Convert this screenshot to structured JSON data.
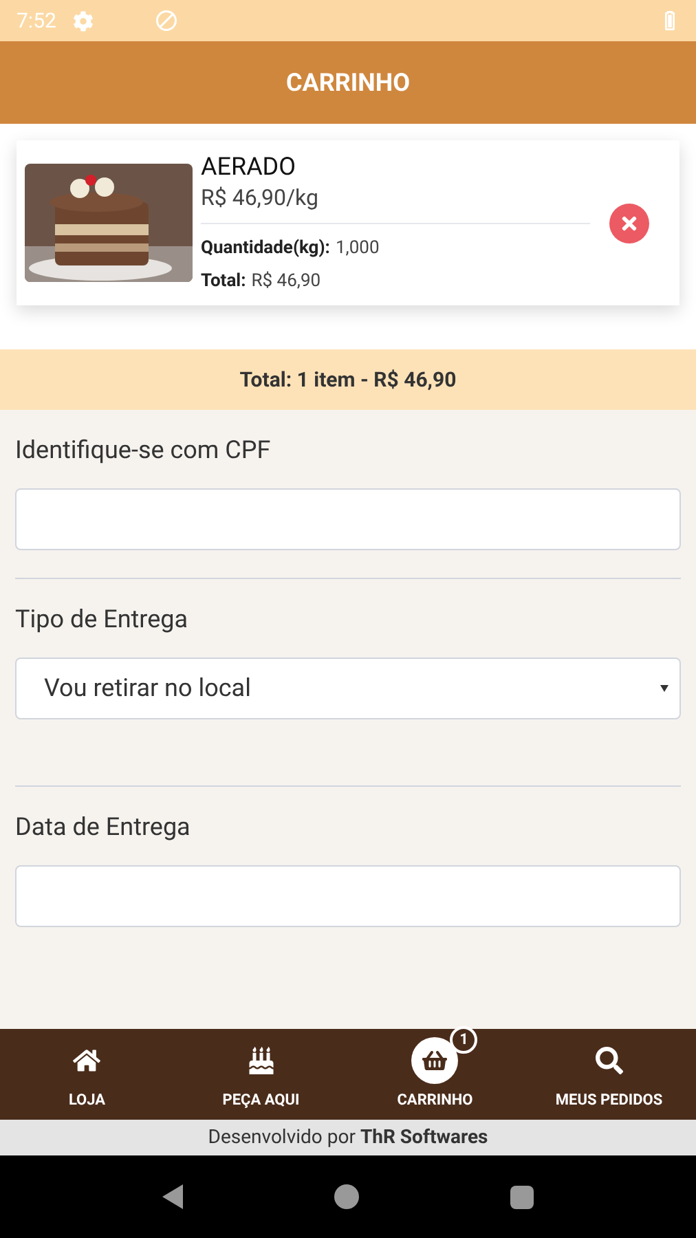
{
  "status_bar": {
    "time": "7:52"
  },
  "header": {
    "title": "CARRINHO"
  },
  "cart_items": [
    {
      "kind": "picture",
      "name": "AERADO",
      "unit_price": "R$ 46,90/kg",
      "quantity_label": "Quantidade(kg):",
      "quantity": "1,000",
      "total_label": "Total:",
      "total": "R$ 46,90"
    }
  ],
  "summary": "Total: 1 item - R$ 46,90",
  "form": [
    {
      "kind": "input",
      "label": "Identifique-se com CPF"
    },
    {
      "kind": "select",
      "label": "Tipo de Entrega",
      "value": "Vou retirar no local"
    },
    {
      "kind": "input",
      "label": "Data de Entrega"
    }
  ],
  "bottom_nav": [
    {
      "label": "LOJA",
      "kind": "home",
      "selected": false
    },
    {
      "label": "PEÇA AQUI",
      "kind": "cake",
      "selected": false
    },
    {
      "label": "CARRINHO",
      "kind": "basket",
      "selected": true,
      "badge": "1"
    },
    {
      "label": "MEUS PEDIDOS",
      "kind": "search",
      "selected": false
    }
  ],
  "footer": "Desenvolvido por **ThR Softwares**"
}
